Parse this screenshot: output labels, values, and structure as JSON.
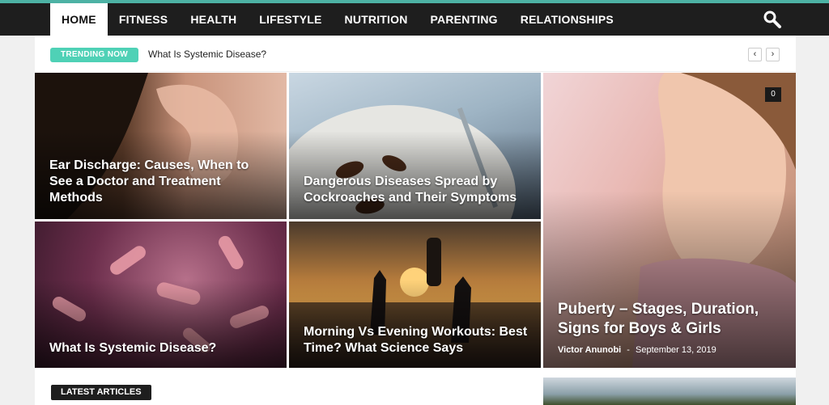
{
  "colors": {
    "accent": "#4db2a4",
    "trending_badge": "#4fd1b6",
    "nav_bg": "#1e1e1e"
  },
  "nav": {
    "items": [
      {
        "label": "HOME"
      },
      {
        "label": "FITNESS"
      },
      {
        "label": "HEALTH"
      },
      {
        "label": "LIFESTYLE"
      },
      {
        "label": "NUTRITION"
      },
      {
        "label": "PARENTING"
      },
      {
        "label": "RELATIONSHIPS"
      }
    ],
    "active_index": 0,
    "search_icon": "search-icon"
  },
  "trending": {
    "badge": "TRENDING NOW",
    "title": "What Is Systemic Disease?",
    "prev": "‹",
    "next": "›"
  },
  "featured": [
    {
      "title": "Ear Discharge: Causes, When to See a Doctor and Treatment Methods"
    },
    {
      "title": "Dangerous Diseases Spread by Cockroaches and Their Symptoms"
    },
    {
      "title": "Puberty – Stages, Duration, Signs for Boys & Girls",
      "comments": "0",
      "author": "Victor Anunobi",
      "separator": "-",
      "date": "September 13, 2019"
    },
    {
      "title": "What Is Systemic Disease?"
    },
    {
      "title": "Morning Vs Evening Workouts: Best Time? What Science Says"
    }
  ],
  "latest": {
    "label": "LATEST ARTICLES"
  }
}
